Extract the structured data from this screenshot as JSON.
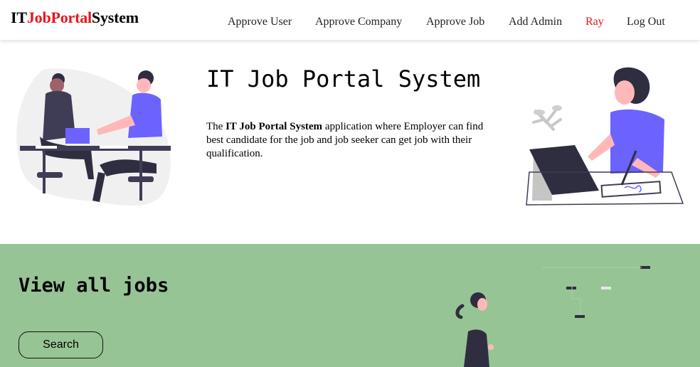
{
  "brand": {
    "part1": "IT",
    "part2": "JobPortal",
    "part3": "System"
  },
  "nav": {
    "approve_user": "Approve User",
    "approve_company": "Approve Company",
    "approve_job": "Approve Job",
    "add_admin": "Add Admin",
    "user": "Ray",
    "logout": "Log Out"
  },
  "hero": {
    "title": "IT Job Portal System",
    "desc_prefix": "The ",
    "desc_bold": "IT Job Portal System",
    "desc_rest": " application where Employer can find best candidate for the job and job seeker can get job with their qualification."
  },
  "jobs_section": {
    "title": "View all jobs",
    "search_label": "Search"
  },
  "colors": {
    "brand_accent": "#e8141c",
    "section_green": "#97c494",
    "illustration_purple": "#6c63ff"
  },
  "icons": [
    "handshake-illustration",
    "working-at-desk-illustration",
    "walking-woman-illustration"
  ]
}
